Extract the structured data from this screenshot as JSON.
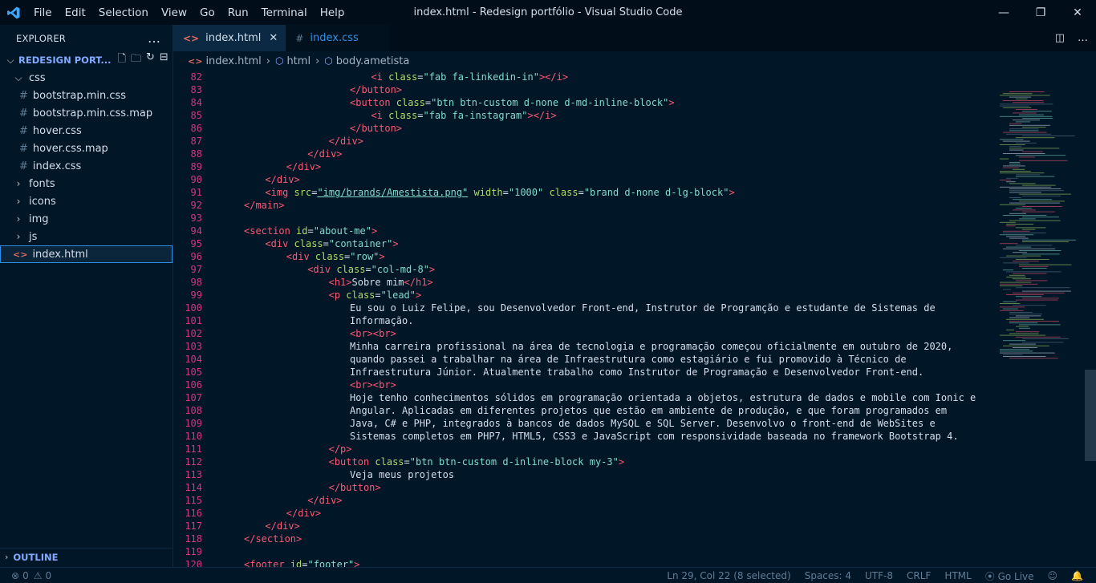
{
  "window": {
    "title": "index.html - Redesign portfólio - Visual Studio Code",
    "menu": [
      "File",
      "Edit",
      "Selection",
      "View",
      "Go",
      "Run",
      "Terminal",
      "Help"
    ]
  },
  "sidebar": {
    "header": "EXPLORER",
    "folder": "REDESIGN PORT...",
    "tree": [
      {
        "label": "css",
        "type": "folder-open",
        "indent": 1
      },
      {
        "label": "bootstrap.min.css",
        "type": "css",
        "indent": 2
      },
      {
        "label": "bootstrap.min.css.map",
        "type": "css",
        "indent": 2
      },
      {
        "label": "hover.css",
        "type": "css",
        "indent": 2
      },
      {
        "label": "hover.css.map",
        "type": "css",
        "indent": 2
      },
      {
        "label": "index.css",
        "type": "css",
        "indent": 2
      },
      {
        "label": "fonts",
        "type": "folder",
        "indent": 1
      },
      {
        "label": "icons",
        "type": "folder",
        "indent": 1
      },
      {
        "label": "img",
        "type": "folder",
        "indent": 1
      },
      {
        "label": "js",
        "type": "folder",
        "indent": 1
      },
      {
        "label": "index.html",
        "type": "html",
        "indent": 1,
        "selected": true
      }
    ],
    "outline": "OUTLINE"
  },
  "tabs": [
    {
      "label": "index.html",
      "active": true
    },
    {
      "label": "index.css",
      "active": false
    }
  ],
  "breadcrumb": [
    "index.html",
    "html",
    "body.ametista"
  ],
  "code": [
    {
      "n": "82",
      "indent": 24,
      "parts": [
        [
          "tag",
          "<i "
        ],
        [
          "attr",
          "class"
        ],
        [
          "eq",
          "="
        ],
        [
          "str2",
          "\"fab fa-linkedin-in\""
        ],
        [
          "tag",
          "></i>"
        ]
      ]
    },
    {
      "n": "83",
      "indent": 20,
      "parts": [
        [
          "tag",
          "</button>"
        ]
      ]
    },
    {
      "n": "84",
      "indent": 20,
      "parts": [
        [
          "tag",
          "<button "
        ],
        [
          "attr",
          "class"
        ],
        [
          "eq",
          "="
        ],
        [
          "str2",
          "\"btn btn-custom d-none d-md-inline-block\""
        ],
        [
          "tag",
          ">"
        ]
      ]
    },
    {
      "n": "85",
      "indent": 24,
      "parts": [
        [
          "tag",
          "<i "
        ],
        [
          "attr",
          "class"
        ],
        [
          "eq",
          "="
        ],
        [
          "str2",
          "\"fab fa-instagram\""
        ],
        [
          "tag",
          "></i>"
        ]
      ]
    },
    {
      "n": "86",
      "indent": 20,
      "parts": [
        [
          "tag",
          "</button>"
        ]
      ]
    },
    {
      "n": "87",
      "indent": 16,
      "parts": [
        [
          "tag",
          "</div>"
        ]
      ]
    },
    {
      "n": "88",
      "indent": 12,
      "parts": [
        [
          "tag",
          "</div>"
        ]
      ]
    },
    {
      "n": "89",
      "indent": 8,
      "parts": [
        [
          "tag",
          "</div>"
        ]
      ]
    },
    {
      "n": "90",
      "indent": 4,
      "parts": [
        [
          "tag",
          "</div>"
        ]
      ]
    },
    {
      "n": "91",
      "indent": 4,
      "parts": [
        [
          "tag",
          "<img "
        ],
        [
          "attr",
          "src"
        ],
        [
          "eq",
          "="
        ],
        [
          "str2",
          "\"img/brands/Amestista.png\""
        ],
        [
          "tag",
          " "
        ],
        [
          "attr",
          "width"
        ],
        [
          "eq",
          "="
        ],
        [
          "str2",
          "\"1000\""
        ],
        [
          "tag",
          " "
        ],
        [
          "attr",
          "class"
        ],
        [
          "eq",
          "="
        ],
        [
          "str2",
          "\"brand d-none d-lg-block\""
        ],
        [
          "tag",
          ">"
        ]
      ]
    },
    {
      "n": "92",
      "indent": 0,
      "parts": [
        [
          "tag",
          "</main>"
        ]
      ]
    },
    {
      "n": "93",
      "indent": 0,
      "parts": []
    },
    {
      "n": "94",
      "indent": 0,
      "parts": [
        [
          "tag",
          "<section "
        ],
        [
          "attr",
          "id"
        ],
        [
          "eq",
          "="
        ],
        [
          "str2",
          "\"about-me\""
        ],
        [
          "tag",
          ">"
        ]
      ]
    },
    {
      "n": "95",
      "indent": 4,
      "parts": [
        [
          "tag",
          "<div "
        ],
        [
          "attr",
          "class"
        ],
        [
          "eq",
          "="
        ],
        [
          "str2",
          "\"container\""
        ],
        [
          "tag",
          ">"
        ]
      ]
    },
    {
      "n": "96",
      "indent": 8,
      "parts": [
        [
          "tag",
          "<div "
        ],
        [
          "attr",
          "class"
        ],
        [
          "eq",
          "="
        ],
        [
          "str2",
          "\"row\""
        ],
        [
          "tag",
          ">"
        ]
      ]
    },
    {
      "n": "97",
      "indent": 12,
      "parts": [
        [
          "tag",
          "<div "
        ],
        [
          "attr",
          "class"
        ],
        [
          "eq",
          "="
        ],
        [
          "str2",
          "\"col-md-8\""
        ],
        [
          "tag",
          ">"
        ]
      ]
    },
    {
      "n": "98",
      "indent": 16,
      "parts": [
        [
          "tag",
          "<h1>"
        ],
        [
          "text",
          "Sobre mim"
        ],
        [
          "tag",
          "</h1>"
        ]
      ]
    },
    {
      "n": "99",
      "indent": 16,
      "parts": [
        [
          "tag",
          "<p "
        ],
        [
          "attr",
          "class"
        ],
        [
          "eq",
          "="
        ],
        [
          "str2",
          "\"lead\""
        ],
        [
          "tag",
          ">"
        ]
      ]
    },
    {
      "n": "100",
      "indent": 20,
      "parts": [
        [
          "text",
          "Eu sou o Luiz Felipe, sou Desenvolvedor Front-end, Instrutor de Programção e estudante de Sistemas de"
        ]
      ]
    },
    {
      "n": "101",
      "indent": 20,
      "parts": [
        [
          "text",
          "Informação."
        ]
      ]
    },
    {
      "n": "102",
      "indent": 20,
      "parts": [
        [
          "tag",
          "<br><br>"
        ]
      ]
    },
    {
      "n": "103",
      "indent": 20,
      "parts": [
        [
          "text",
          "Minha carreira profissional na área de tecnologia e programação começou oficialmente em outubro de 2020,"
        ]
      ]
    },
    {
      "n": "104",
      "indent": 20,
      "parts": [
        [
          "text",
          "quando passei a trabalhar na área de Infraestrutura como estagiário e fui promovido à Técnico de"
        ]
      ]
    },
    {
      "n": "105",
      "indent": 20,
      "parts": [
        [
          "text",
          "Infraestrutura Júnior. Atualmente trabalho como Instrutor de Programação e Desenvolvedor Front-end."
        ]
      ]
    },
    {
      "n": "106",
      "indent": 20,
      "parts": [
        [
          "tag",
          "<br><br>"
        ]
      ]
    },
    {
      "n": "107",
      "indent": 20,
      "parts": [
        [
          "text",
          "Hoje tenho conhecimentos sólidos em programação orientada a objetos, estrutura de dados e mobile com Ionic e"
        ]
      ]
    },
    {
      "n": "108",
      "indent": 20,
      "parts": [
        [
          "text",
          "Angular. Aplicadas em diferentes projetos que estão em ambiente de produção, e que foram programados em"
        ]
      ]
    },
    {
      "n": "109",
      "indent": 20,
      "parts": [
        [
          "text",
          "Java, C# e PHP, integrados à bancos de dados MySQL e SQL Server. Desenvolvo o front-end de WebSites e"
        ]
      ]
    },
    {
      "n": "110",
      "indent": 20,
      "parts": [
        [
          "text",
          "Sistemas completos em PHP7, HTML5, CSS3 e JavaScript com responsividade baseada no framework Bootstrap 4."
        ]
      ]
    },
    {
      "n": "111",
      "indent": 16,
      "parts": [
        [
          "tag",
          "</p>"
        ]
      ]
    },
    {
      "n": "112",
      "indent": 16,
      "parts": [
        [
          "tag",
          "<button "
        ],
        [
          "attr",
          "class"
        ],
        [
          "eq",
          "="
        ],
        [
          "str2",
          "\"btn btn-custom d-inline-block my-3\""
        ],
        [
          "tag",
          ">"
        ]
      ]
    },
    {
      "n": "113",
      "indent": 20,
      "parts": [
        [
          "text",
          "Veja meus projetos"
        ]
      ]
    },
    {
      "n": "114",
      "indent": 16,
      "parts": [
        [
          "tag",
          "</button>"
        ]
      ]
    },
    {
      "n": "115",
      "indent": 12,
      "parts": [
        [
          "tag",
          "</div>"
        ]
      ]
    },
    {
      "n": "116",
      "indent": 8,
      "parts": [
        [
          "tag",
          "</div>"
        ]
      ]
    },
    {
      "n": "117",
      "indent": 4,
      "parts": [
        [
          "tag",
          "</div>"
        ]
      ]
    },
    {
      "n": "118",
      "indent": 0,
      "parts": [
        [
          "tag",
          "</section>"
        ]
      ]
    },
    {
      "n": "119",
      "indent": 0,
      "parts": []
    },
    {
      "n": "120",
      "indent": 0,
      "parts": [
        [
          "tag",
          "<footer "
        ],
        [
          "attr",
          "id"
        ],
        [
          "eq",
          "="
        ],
        [
          "str2",
          "\"footer\""
        ],
        [
          "tag",
          ">"
        ]
      ]
    }
  ],
  "statusbar": {
    "errors": "0",
    "warnings": "0",
    "position": "Ln 29, Col 22 (8 selected)",
    "spaces": "Spaces: 4",
    "encoding": "UTF-8",
    "eol": "CRLF",
    "language": "HTML",
    "golive": "Go Live"
  },
  "colors": {
    "background": "#011627",
    "tag": "#ff5874",
    "attr": "#addb67",
    "string": "#7fdbca",
    "accent": "#82aaff"
  }
}
